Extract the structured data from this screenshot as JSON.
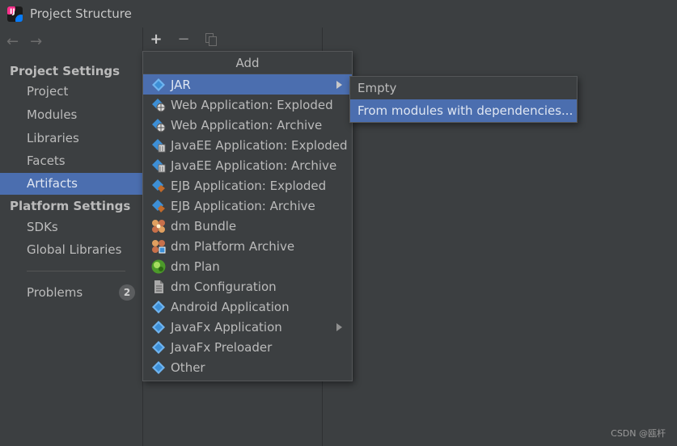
{
  "window": {
    "title": "Project Structure"
  },
  "sidebar": {
    "project_settings_heading": "Project Settings",
    "project_items": [
      "Project",
      "Modules",
      "Libraries",
      "Facets",
      "Artifacts"
    ],
    "platform_settings_heading": "Platform Settings",
    "platform_items": [
      "SDKs",
      "Global Libraries"
    ],
    "problems_label": "Problems",
    "problems_count": "2",
    "selected": "Artifacts"
  },
  "toolbar": {
    "add_icon": "plus-icon",
    "remove_icon": "minus-icon",
    "copy_icon": "copy-icon"
  },
  "add_menu": {
    "header": "Add",
    "items": [
      {
        "label": "JAR",
        "icon": "jar-icon",
        "submenu": true
      },
      {
        "label": "Web Application: Exploded",
        "icon": "web-app-icon"
      },
      {
        "label": "Web Application: Archive",
        "icon": "web-app-icon"
      },
      {
        "label": "JavaEE Application: Exploded",
        "icon": "javaee-icon"
      },
      {
        "label": "JavaEE Application: Archive",
        "icon": "javaee-icon"
      },
      {
        "label": "EJB Application: Exploded",
        "icon": "ejb-icon"
      },
      {
        "label": "EJB Application: Archive",
        "icon": "ejb-icon"
      },
      {
        "label": "dm Bundle",
        "icon": "dm-bundle-icon"
      },
      {
        "label": "dm Platform Archive",
        "icon": "dm-platform-icon"
      },
      {
        "label": "dm Plan",
        "icon": "dm-plan-icon"
      },
      {
        "label": "dm Configuration",
        "icon": "dm-config-icon"
      },
      {
        "label": "Android Application",
        "icon": "android-icon"
      },
      {
        "label": "JavaFx Application",
        "icon": "javafx-icon",
        "submenu": true
      },
      {
        "label": "JavaFx Preloader",
        "icon": "javafx-icon"
      },
      {
        "label": "Other",
        "icon": "artifact-icon"
      }
    ],
    "selected": "JAR"
  },
  "jar_submenu": {
    "items": [
      "Empty",
      "From modules with dependencies..."
    ],
    "selected": "From modules with dependencies..."
  },
  "watermark": "CSDN @瓯杆",
  "colors": {
    "background": "#3c3f41",
    "selection": "#4b6eaf",
    "diamond": "#3d8fd6",
    "badge": "#5b5d5f"
  }
}
